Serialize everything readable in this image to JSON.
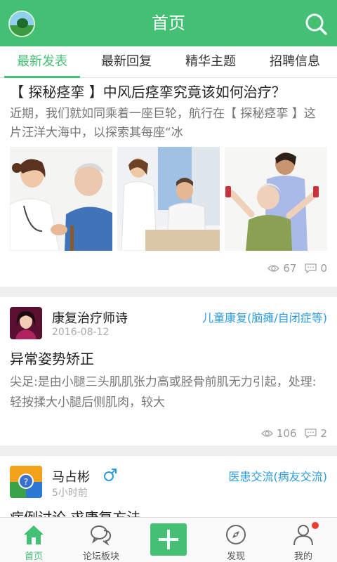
{
  "header": {
    "title": "首页",
    "search_icon": "search-icon",
    "avatar": "user-avatar"
  },
  "tabs": [
    {
      "label": "最新发表",
      "active": true
    },
    {
      "label": "最新回复",
      "active": false
    },
    {
      "label": "精华主题",
      "active": false
    },
    {
      "label": "招聘信息",
      "active": false
    }
  ],
  "feed": {
    "post1": {
      "title": "【 探秘痉挛 】中风后痉挛究竟该如何治疗？",
      "excerpt": "近期，我们就如同乘着一座巨轮，航行在【 探秘痉挛 】这片汪洋大海中，以探索其每座“冰",
      "views": "67",
      "comments": "0"
    },
    "post2": {
      "author": "康复治疗师诗",
      "date": "2016-08-12",
      "category": "儿童康复(脑瘫/自闭症等)",
      "title": "异常姿势矫正",
      "body": "尖足:是由小腿三头肌肌张力高或胫骨前肌无力引起，处理:轻按揉大小腿后侧肌肉，较大",
      "views": "106",
      "comments": "2"
    },
    "post3": {
      "author": "马占彬",
      "gender_icon": "male-icon",
      "date": "5小时前",
      "category": "医患交流(病友交流)",
      "title": "病例讨论 求康复方法"
    }
  },
  "bottom_nav": [
    {
      "label": "首页",
      "icon": "home-icon",
      "active": true
    },
    {
      "label": "论坛板块",
      "icon": "chat-icon",
      "active": false
    },
    {
      "label": "",
      "icon": "plus-icon",
      "active": false
    },
    {
      "label": "发现",
      "icon": "compass-icon",
      "active": false
    },
    {
      "label": "我的",
      "icon": "person-icon",
      "active": false
    }
  ],
  "colors": {
    "brand": "#43c073",
    "link": "#2d9be0",
    "badge": "#ef3b2f"
  }
}
